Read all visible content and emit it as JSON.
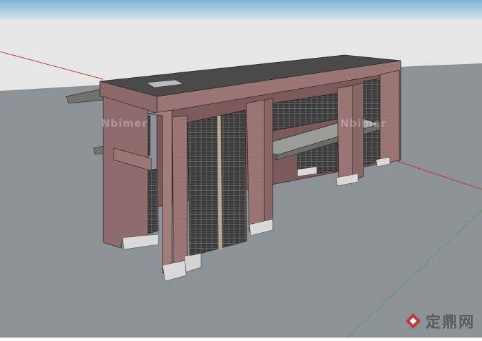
{
  "scene": {
    "colors": {
      "sky": "#c9dbe6",
      "horizon": "#e6e6e6",
      "ground": "#8c9196",
      "brick": "#9c7575",
      "brick_dark": "#7a5757",
      "roof": "#4a4a4a",
      "screen": "#3b3b3b",
      "plinth": "#d9d9d9",
      "canopy": "#777a75",
      "axis_red": "#c0393b",
      "axis_green": "#3aa24b"
    }
  },
  "watermarks": {
    "left": "Nbimer",
    "right": "Nbimer"
  },
  "brand": {
    "logo_icon": "diamond-logo-icon",
    "text": "定鼎网"
  }
}
